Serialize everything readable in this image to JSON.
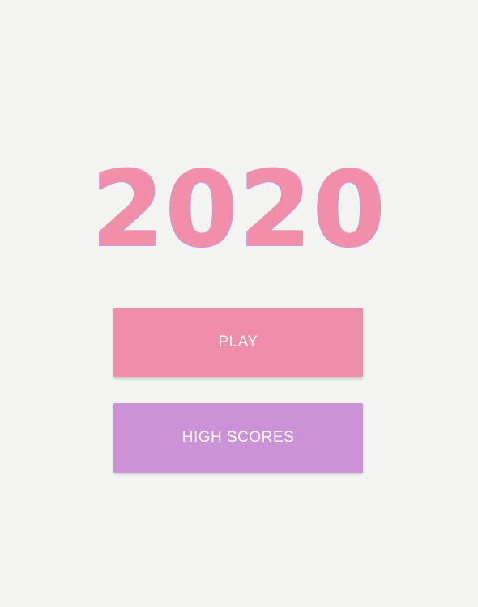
{
  "game": {
    "title": "2020"
  },
  "menu": {
    "play_label": "PLAY",
    "high_scores_label": "HIGH SCORES"
  },
  "colors": {
    "background": "#f3f4f2",
    "title": "#f28eaa",
    "play_button": "#f18dac",
    "high_scores_button": "#cc92d8",
    "button_text": "#ffffff"
  }
}
